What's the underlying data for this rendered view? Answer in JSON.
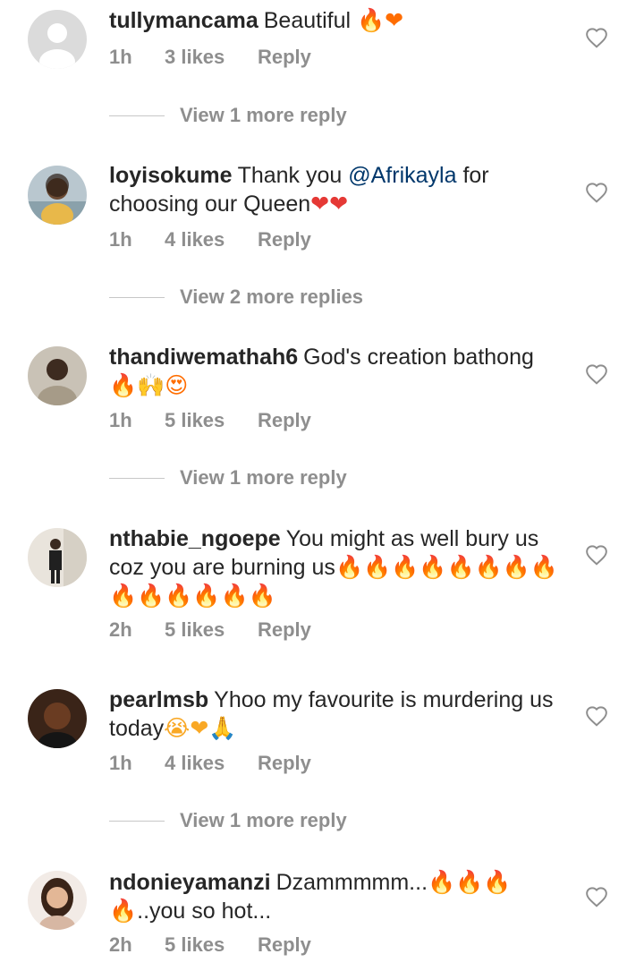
{
  "comments": [
    {
      "username": "tullymancama",
      "text": "Beautiful ",
      "emoji": "🔥❤",
      "time": "1h",
      "likes": "3 likes",
      "reply": "Reply",
      "view_more": "View 1 more reply"
    },
    {
      "username": "loyisokume",
      "text_before": "Thank you ",
      "mention": "@Afrikayla",
      "text_after": " for choosing our Queen",
      "emoji": "❤❤",
      "time": "1h",
      "likes": "4 likes",
      "reply": "Reply",
      "view_more": "View 2 more replies"
    },
    {
      "username": "thandiwemathah6",
      "text": "God's  creation bathong",
      "emoji": "🔥🙌😍",
      "time": "1h",
      "likes": "5 likes",
      "reply": "Reply",
      "view_more": "View 1 more reply"
    },
    {
      "username": "nthabie_ngoepe",
      "text": "You might as well bury us coz you are burning us",
      "emoji": "🔥🔥🔥🔥🔥🔥🔥🔥🔥🔥🔥🔥🔥🔥",
      "time": "2h",
      "likes": "5 likes",
      "reply": "Reply"
    },
    {
      "username": "pearlmsb",
      "text": "Yhoo my favourite is murdering us today",
      "emoji": "😭❤🙏",
      "time": "1h",
      "likes": "4 likes",
      "reply": "Reply",
      "view_more": "View 1 more reply"
    },
    {
      "username": "ndonieyamanzi",
      "text": "Dzammmmm...",
      "emoji": "🔥🔥🔥🔥",
      "text_after": "..you so hot...",
      "time": "2h",
      "likes": "5 likes",
      "reply": "Reply"
    }
  ],
  "colors": {
    "text": "#262626",
    "meta": "#8e8e8e",
    "mention": "#00376b",
    "divider": "#c7c7c7"
  },
  "icons": [
    "heart-outline-icon",
    "avatar"
  ]
}
